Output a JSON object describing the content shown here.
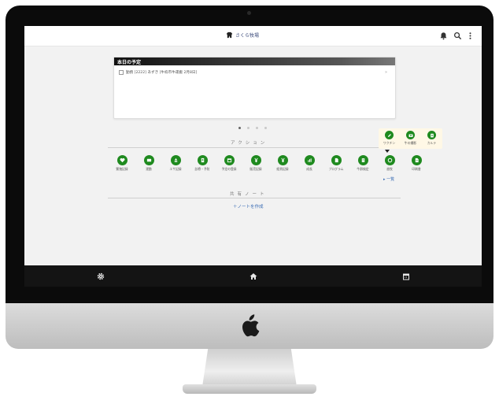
{
  "app": {
    "brand": "さくら牧場"
  },
  "schedule": {
    "title": "本日の予定",
    "items": [
      {
        "text": "勤務 [2222] あずき [牛枠市牛運搬 2月8日]"
      }
    ],
    "more": "»"
  },
  "carousel": {
    "pages": 4,
    "active": 0
  },
  "actions": {
    "title": "アクション",
    "items": [
      {
        "label": "繁殖記録",
        "icon": "heart-icon"
      },
      {
        "label": "運動",
        "icon": "truck-icon"
      },
      {
        "label": "エサ記録",
        "icon": "feed-icon"
      },
      {
        "label": "診療・予防",
        "icon": "medical-icon"
      },
      {
        "label": "予定の登録",
        "icon": "calendar-icon"
      },
      {
        "label": "販売記録",
        "icon": "yen-icon"
      },
      {
        "label": "経費記録",
        "icon": "yen-icon"
      },
      {
        "label": "成長",
        "icon": "chart-icon"
      },
      {
        "label": "プログラム",
        "icon": "document-icon"
      },
      {
        "label": "牛群検定",
        "icon": "clipboard-icon"
      },
      {
        "label": "放牧",
        "icon": "circle-icon"
      },
      {
        "label": "印刷書",
        "icon": "file-icon"
      }
    ],
    "sub_items": [
      {
        "label": "ワクチン",
        "icon": "pencil-icon"
      },
      {
        "label": "牛の撮影",
        "icon": "camera-icon"
      },
      {
        "label": "カルテ",
        "icon": "clipboard-icon"
      }
    ],
    "more": "▸ 一覧"
  },
  "notes": {
    "title": "共有ノート",
    "create": "＋ノートを作成"
  },
  "colors": {
    "accent": "#1f8a1f",
    "link": "#3b6db5",
    "header_dark": "#111111",
    "bottom_bar": "#141414"
  }
}
